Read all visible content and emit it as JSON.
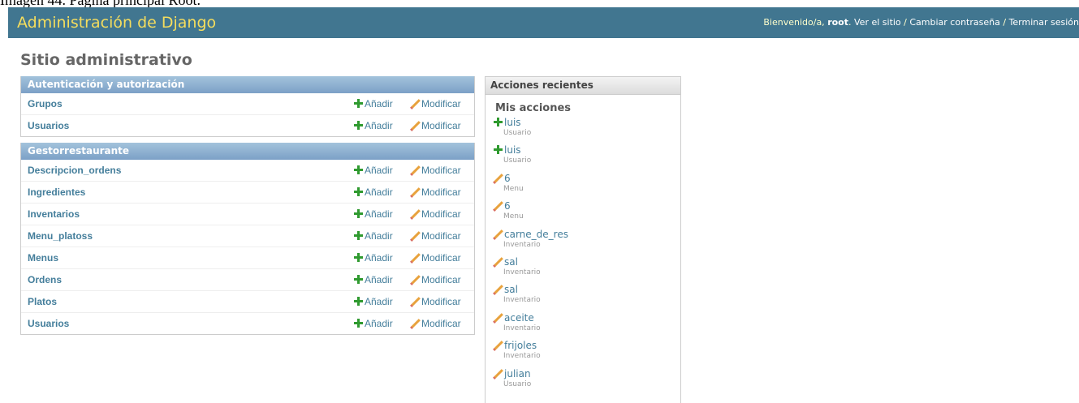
{
  "caption": "Imagen 44. Página principal Root.",
  "header": {
    "branding": "Administración de Django",
    "welcome": "Bienvenido/a,",
    "user": "root",
    "view_site": "Ver el sitio",
    "change_password": "Cambiar contraseña",
    "logout": "Terminar sesión"
  },
  "page_title": "Sitio administrativo",
  "modules": [
    {
      "caption": "Autenticación y autorización",
      "rows": [
        {
          "name": "Grupos",
          "add": "Añadir",
          "change": "Modificar"
        },
        {
          "name": "Usuarios",
          "add": "Añadir",
          "change": "Modificar"
        }
      ]
    },
    {
      "caption": "Gestorrestaurante",
      "rows": [
        {
          "name": "Descripcion_ordens",
          "add": "Añadir",
          "change": "Modificar"
        },
        {
          "name": "Ingredientes",
          "add": "Añadir",
          "change": "Modificar"
        },
        {
          "name": "Inventarios",
          "add": "Añadir",
          "change": "Modificar"
        },
        {
          "name": "Menu_platoss",
          "add": "Añadir",
          "change": "Modificar"
        },
        {
          "name": "Menus",
          "add": "Añadir",
          "change": "Modificar"
        },
        {
          "name": "Ordens",
          "add": "Añadir",
          "change": "Modificar"
        },
        {
          "name": "Platos",
          "add": "Añadir",
          "change": "Modificar"
        },
        {
          "name": "Usuarios",
          "add": "Añadir",
          "change": "Modificar"
        }
      ]
    }
  ],
  "recent": {
    "caption": "Acciones recientes",
    "heading": "Mis acciones",
    "items": [
      {
        "icon": "plus-icon",
        "title": "luis",
        "model": "Usuario"
      },
      {
        "icon": "plus-icon",
        "title": "luis",
        "model": "Usuario"
      },
      {
        "icon": "pencil-icon",
        "title": "6",
        "model": "Menu"
      },
      {
        "icon": "pencil-icon",
        "title": "6",
        "model": "Menu"
      },
      {
        "icon": "pencil-icon",
        "title": "carne_de_res",
        "model": "Inventario"
      },
      {
        "icon": "pencil-icon",
        "title": "sal",
        "model": "Inventario"
      },
      {
        "icon": "pencil-icon",
        "title": "sal",
        "model": "Inventario"
      },
      {
        "icon": "pencil-icon",
        "title": "aceite",
        "model": "Inventario"
      },
      {
        "icon": "pencil-icon",
        "title": "frijoles",
        "model": "Inventario"
      },
      {
        "icon": "pencil-icon",
        "title": "julian",
        "model": "Usuario"
      }
    ]
  },
  "colors": {
    "header_bg": "#417690",
    "branding": "#f5dd5d",
    "module_caption": "#79aec8",
    "link": "#447e9b",
    "add_icon": "#2f9a2f"
  }
}
